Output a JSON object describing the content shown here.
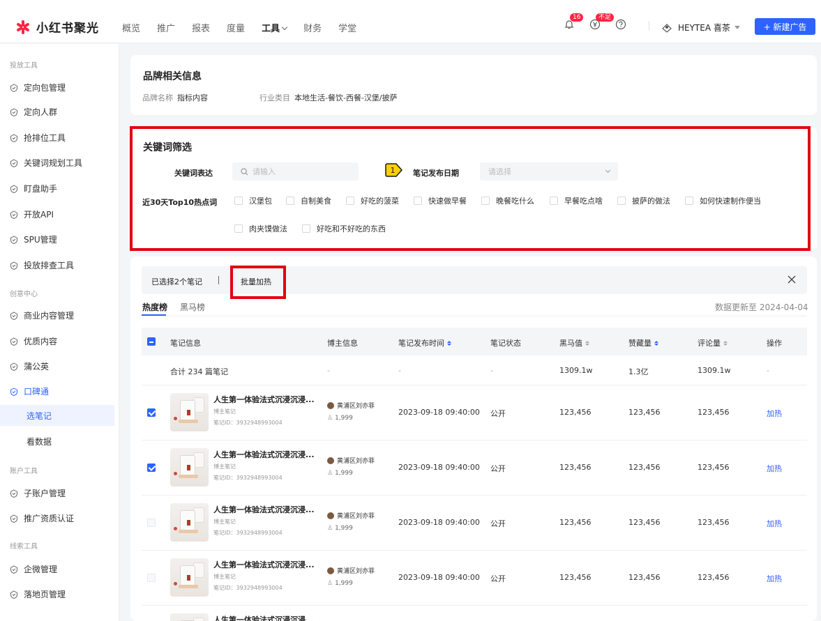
{
  "app": {
    "brand": "小红书聚光",
    "nav": [
      "概览",
      "推广",
      "报表",
      "度量",
      "工具",
      "财务",
      "学堂"
    ],
    "active_nav": "工具",
    "badges": {
      "notifications": "16",
      "wallet": "不足"
    },
    "account": "HEYTEA 喜茶",
    "new_ad_label": "+ 新建广告",
    "accent_color": "#2d63ff",
    "brand_color": "#ff2442",
    "icons": [
      "bell-icon",
      "yuan-icon",
      "help-icon",
      "account-icon",
      "chevron-down-icon"
    ]
  },
  "sidebar": {
    "group_launch": "投放工具",
    "launch_items": [
      "定向包管理",
      "定向人群",
      "抢排位工具",
      "关键词规划工具",
      "盯盘助手",
      "开放API",
      "SPU管理",
      "投放排查工具"
    ],
    "group_creative": "创意中心",
    "creative_items": [
      "商业内容管理",
      "优质内容",
      "蒲公英",
      "口碑通"
    ],
    "creative_subitems": [
      "选笔记",
      "看数据"
    ],
    "group_account": "账户工具",
    "account_items": [
      "子账户管理",
      "推广资质认证"
    ],
    "group_leads": "线索工具",
    "leads_items": [
      "企微管理",
      "落地页管理"
    ]
  },
  "brand_info": {
    "title": "品牌相关信息",
    "brand_name_label": "品牌名称",
    "brand_name_value": "指标内容",
    "industry_label": "行业类目",
    "industry_value": "本地生活-餐饮-西餐-汉堡/披萨"
  },
  "keyword_filter": {
    "title": "关键词筛选",
    "expression_label": "关键词表达",
    "search_placeholder": "请输入",
    "marker_number": "1",
    "publish_date_label": "笔记发布日期",
    "date_placeholder": "请选择",
    "hot_label": "近30天Top10热点词",
    "hot_words": [
      "汉堡包",
      "自制美食",
      "好吃的菠菜",
      "快速做早餐",
      "晚餐吃什么",
      "早餐吃点啥",
      "披萨的做法",
      "如何快速制作便当",
      "肉夹馍做法",
      "好吃和不好吃的东西"
    ]
  },
  "selection": {
    "selected_text": "已选择2个笔记",
    "batch_label": "批量加热"
  },
  "tabs": [
    "热度榜",
    "黑马榜"
  ],
  "update_text": "数据更新至 2024-04-04",
  "table": {
    "headers": [
      "笔记信息",
      "博主信息",
      "笔记发布时间",
      "笔记状态",
      "黑马值",
      "赞藏量",
      "评论量",
      "操作"
    ],
    "summary": [
      "合计 234 篇笔记",
      "-",
      "-",
      "-",
      "1309.1w",
      "1.3亿",
      "1309.1w",
      "-"
    ],
    "rows": [
      {
        "checked": true,
        "title": "人生第一体验法式沉浸沉浸...",
        "sub": "博主笔记",
        "note_id": "笔记ID：3932948993004",
        "blogger": "黄浦区刘亦菲",
        "fans": "1,999",
        "time": "2023-09-18 09:40:00",
        "status": "公开",
        "dark_horse": "123,456",
        "likes": "123,456",
        "comments": "123,456",
        "action": "加热"
      },
      {
        "checked": true,
        "title": "人生第一体验法式沉浸沉浸...",
        "sub": "博主笔记",
        "note_id": "笔记ID：3932948993004",
        "blogger": "黄浦区刘亦菲",
        "fans": "1,999",
        "time": "2023-09-18 09:40:00",
        "status": "公开",
        "dark_horse": "123,456",
        "likes": "123,456",
        "comments": "123,456",
        "action": "加热"
      },
      {
        "checked": false,
        "title": "人生第一体验法式沉浸沉浸...",
        "sub": "博主笔记",
        "note_id": "笔记ID：3932948993004",
        "blogger": "黄浦区刘亦菲",
        "fans": "1,999",
        "time": "2023-09-18 09:40:00",
        "status": "公开",
        "dark_horse": "123,456",
        "likes": "123,456",
        "comments": "123,456",
        "action": "加热"
      },
      {
        "checked": false,
        "title": "人生第一体验法式沉浸沉浸...",
        "sub": "博主笔记",
        "note_id": "笔记ID：3932948993004",
        "blogger": "黄浦区刘亦菲",
        "fans": "1,999",
        "time": "2023-09-18 09:40:00",
        "status": "公开",
        "dark_horse": "123,456",
        "likes": "123,456",
        "comments": "123,456",
        "action": "加热"
      },
      {
        "checked": false,
        "title": "人生第一体验法式沉浸沉浸..."
      }
    ]
  }
}
